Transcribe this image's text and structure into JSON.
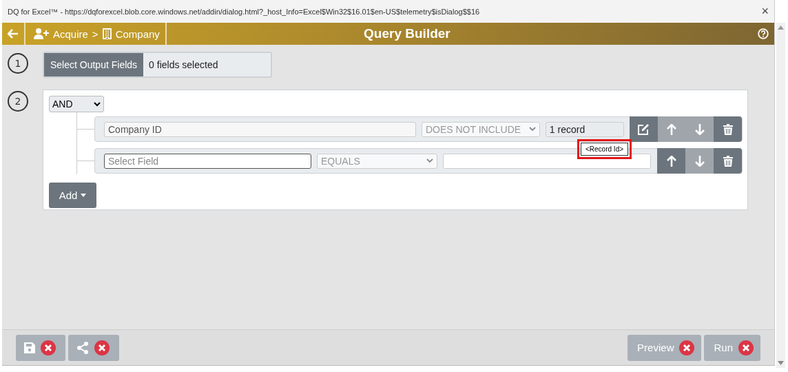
{
  "window": {
    "title": "DQ for Excel™ - https://dqforexcel.blob.core.windows.net/addin/dialog.html?_host_Info=Excel$Win32$16.01$en-US$telemetry$isDialog$$16",
    "close": "×"
  },
  "header": {
    "breadcrumb": [
      "Acquire",
      ">",
      "Company"
    ],
    "title": "Query Builder"
  },
  "step1": {
    "number": "1",
    "button": "Select Output Fields",
    "summary": "0 fields selected"
  },
  "step2": {
    "number": "2",
    "logic": "AND",
    "rules": [
      {
        "kind": "set",
        "field": "Company ID",
        "operator": "DOES NOT INCLUDE",
        "value": "1 record",
        "tooltip": "<Record Id>",
        "buttons": [
          {
            "kind": "edit",
            "disabled": false
          },
          {
            "kind": "up",
            "disabled": true
          },
          {
            "kind": "down",
            "disabled": true
          },
          {
            "kind": "delete",
            "disabled": false
          }
        ]
      },
      {
        "kind": "empty",
        "field": "Select Field",
        "operator": "EQUALS",
        "buttons": [
          {
            "kind": "up",
            "disabled": false
          },
          {
            "kind": "down",
            "disabled": true
          },
          {
            "kind": "delete",
            "disabled": false
          }
        ]
      }
    ],
    "add_button": "Add"
  },
  "footer": {
    "left": [
      {
        "kind": "save"
      },
      {
        "kind": "share"
      }
    ],
    "right": [
      {
        "label": "Preview"
      },
      {
        "label": "Run"
      }
    ]
  }
}
